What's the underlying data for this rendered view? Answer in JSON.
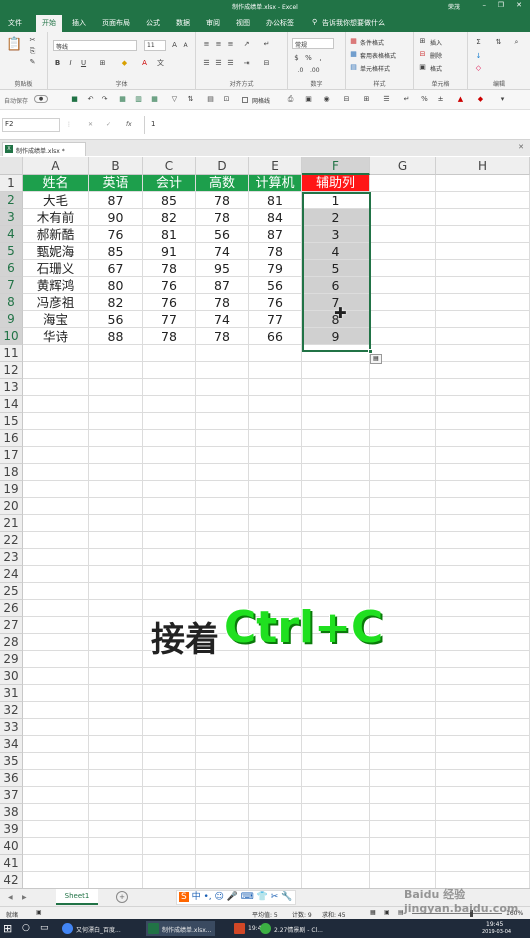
{
  "window": {
    "title": "制作成绩单.xlsx - Excel",
    "user": "荣茂",
    "min": "–",
    "restore": "❐",
    "close": "✕"
  },
  "tabs": [
    "文件",
    "开始",
    "插入",
    "页面布局",
    "公式",
    "数据",
    "审阅",
    "视图",
    "办公标签"
  ],
  "tell_me": "告诉我你想要做什么",
  "ribbon": {
    "font_name": "等线",
    "font_size": "11",
    "number_format": "常规",
    "groups": {
      "clipboard": "剪贴板",
      "font": "字体",
      "align": "对齐方式",
      "number": "数字",
      "styles": "样式",
      "cells": "单元格",
      "edit": "编辑"
    },
    "conditional": "条件格式",
    "table_format": "套用表格格式",
    "cell_style": "单元格样式",
    "insert": "插入",
    "delete": "删除",
    "format": "格式",
    "bold": "B",
    "italic": "I",
    "underline": "U"
  },
  "quick": {
    "autosave": "自动保存",
    "gridlines": "网格线"
  },
  "formula_bar": {
    "name_box": "F2",
    "fx": "fx",
    "value": "1",
    "cancel": "✕",
    "enter": "✓"
  },
  "workbook_tab": "制作成绩单.xlsx *",
  "columns": [
    "A",
    "B",
    "C",
    "D",
    "E",
    "F",
    "G",
    "H"
  ],
  "table": {
    "headers": [
      "姓名",
      "英语",
      "会计",
      "高数",
      "计算机",
      "辅助列"
    ],
    "rows": [
      [
        "大毛",
        "87",
        "85",
        "78",
        "81",
        "1"
      ],
      [
        "木有前",
        "90",
        "82",
        "78",
        "84",
        "2"
      ],
      [
        "郝新酷",
        "76",
        "81",
        "56",
        "87",
        "3"
      ],
      [
        "甄妮海",
        "85",
        "91",
        "74",
        "78",
        "4"
      ],
      [
        "石珊义",
        "67",
        "78",
        "95",
        "79",
        "5"
      ],
      [
        "黄辉鸿",
        "80",
        "76",
        "87",
        "56",
        "6"
      ],
      [
        "冯彦祖",
        "82",
        "76",
        "78",
        "76",
        "7"
      ],
      [
        "海宝",
        "56",
        "77",
        "74",
        "77",
        "8"
      ],
      [
        "华诗",
        "88",
        "78",
        "78",
        "66",
        "9"
      ]
    ]
  },
  "row_numbers": [
    "1",
    "2",
    "3",
    "4",
    "5",
    "6",
    "7",
    "8",
    "9",
    "10",
    "11",
    "12",
    "13",
    "14",
    "15",
    "16",
    "17",
    "18",
    "19",
    "20",
    "21",
    "22",
    "23",
    "24",
    "25",
    "26",
    "27",
    "28",
    "29",
    "30",
    "31",
    "32",
    "33",
    "34",
    "35",
    "36",
    "37",
    "38",
    "39",
    "40",
    "41",
    "42"
  ],
  "caption": {
    "prefix": "接着",
    "keys": "Ctrl+C"
  },
  "sheet": {
    "name": "Sheet1",
    "add": "+"
  },
  "status": {
    "mode": "就绪",
    "average": "平均值: 5",
    "count": "计数: 9",
    "sum": "求和: 45",
    "zoom": "160%"
  },
  "taskbar": {
    "items": [
      "又何漂白_百度...",
      "制作成绩单.xlsx...",
      "19:45",
      "2.27情景剧 - Cl..."
    ],
    "time": "19:45",
    "date": "2019-03-04"
  },
  "watermark": "Baidu 经验 jingyan.baidu.com",
  "colors": {
    "excel_green": "#217346",
    "header_green": "#1d9f4c",
    "header_red": "#ff1616",
    "caption_green": "#20e020"
  }
}
